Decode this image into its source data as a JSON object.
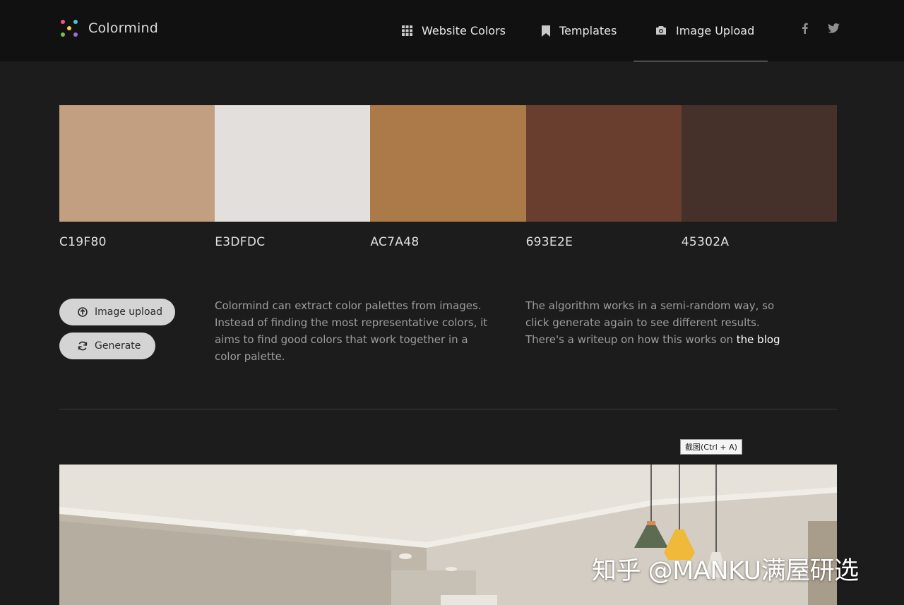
{
  "header": {
    "app_name": "Colormind",
    "nav": [
      {
        "label": "Website Colors",
        "icon": "grid-icon"
      },
      {
        "label": "Templates",
        "icon": "bookmark-icon"
      },
      {
        "label": "Image Upload",
        "icon": "camera-icon",
        "active": true
      }
    ],
    "social": [
      "facebook-icon",
      "twitter-icon"
    ]
  },
  "palette": {
    "colors": [
      "#C19F80",
      "#E3DFDC",
      "#AC7A48",
      "#693E2E",
      "#45302A"
    ],
    "labels": [
      "C19F80",
      "E3DFDC",
      "AC7A48",
      "693E2E",
      "45302A"
    ]
  },
  "actions": {
    "upload_label": "Image upload",
    "generate_label": "Generate"
  },
  "content": {
    "desc_1": "Colormind can extract color palettes from images. Instead of finding the most representative colors, it aims to find good colors that work together in a color palette.",
    "desc_2_text": "The algorithm works in a semi-random way, so click generate again to see different results. There's a writeup on how this works on ",
    "desc_2_link": "the blog"
  },
  "tooltip": "截图(Ctrl + A)",
  "watermark": "知乎 @MANKU满屋研选",
  "colors": {
    "header_bg": "#111111",
    "page_bg": "#1c1c1c",
    "button_bg": "#d4d4d4"
  }
}
